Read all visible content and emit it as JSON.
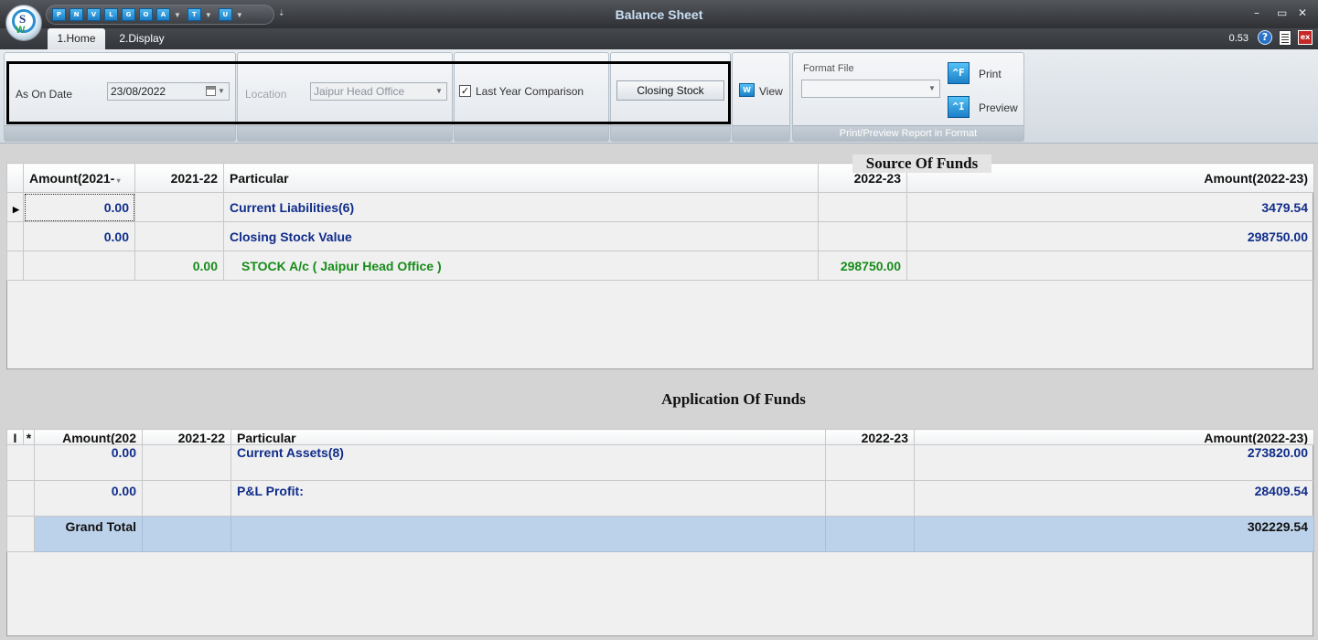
{
  "window": {
    "title": "Balance Sheet",
    "minimize": "–",
    "maximize": "▭",
    "close": "✕",
    "version": "0.53"
  },
  "quick_access": [
    "P",
    "N",
    "V",
    "L",
    "G",
    "O",
    "A",
    "T",
    "U"
  ],
  "tabs": [
    {
      "label": "1.Home",
      "active": true
    },
    {
      "label": "2.Display",
      "active": false
    }
  ],
  "ribbon": {
    "as_on_date_label": "As On Date",
    "as_on_date_value": "23/08/2022",
    "location_label": "Location",
    "location_value": "Jaipur Head Office",
    "last_year_label": "Last Year Comparison",
    "last_year_checked": "✓",
    "closing_stock_button": "Closing Stock",
    "view_label": "View",
    "format_file_label": "Format File",
    "format_file_value": "",
    "print_label": "Print",
    "preview_label": "Preview",
    "print_group_caption": "Print/Preview Report in Format"
  },
  "source": {
    "title": "Source Of Funds",
    "headers": {
      "amount_prev": "Amount(2021-",
      "year_prev": "2021-22",
      "particular": "Particular",
      "year_cur": "2022-23",
      "amount_cur": "Amount(2022-23)"
    },
    "rows": [
      {
        "amount_prev": "0.00",
        "year_prev": "",
        "particular": "Current Liabilities(6)",
        "year_cur": "",
        "amount_cur": "3479.54"
      },
      {
        "amount_prev": "0.00",
        "year_prev": "",
        "particular": "Closing Stock Value",
        "year_cur": "",
        "amount_cur": "298750.00"
      },
      {
        "amount_prev": "",
        "year_prev": "0.00",
        "particular": "STOCK A/c ( Jaipur Head Office )",
        "year_cur": "298750.00",
        "amount_cur": ""
      }
    ]
  },
  "application": {
    "title": "Application Of Funds",
    "headers": {
      "col_i": "I",
      "col_star": "*",
      "amount_prev": "Amount(202",
      "year_prev": "2021-22",
      "particular": "Particular",
      "year_cur": "2022-23",
      "amount_cur": "Amount(2022-23)"
    },
    "rows": [
      {
        "amount_prev": "0.00",
        "year_prev": "",
        "particular": "Current Assets(8)",
        "year_cur": "",
        "amount_cur": "273820.00"
      },
      {
        "amount_prev": "0.00",
        "year_prev": "",
        "particular": "P&L Profit:",
        "year_cur": "",
        "amount_cur": "28409.54"
      }
    ],
    "total": {
      "label": "Grand Total",
      "amount_cur": "302229.54"
    }
  }
}
